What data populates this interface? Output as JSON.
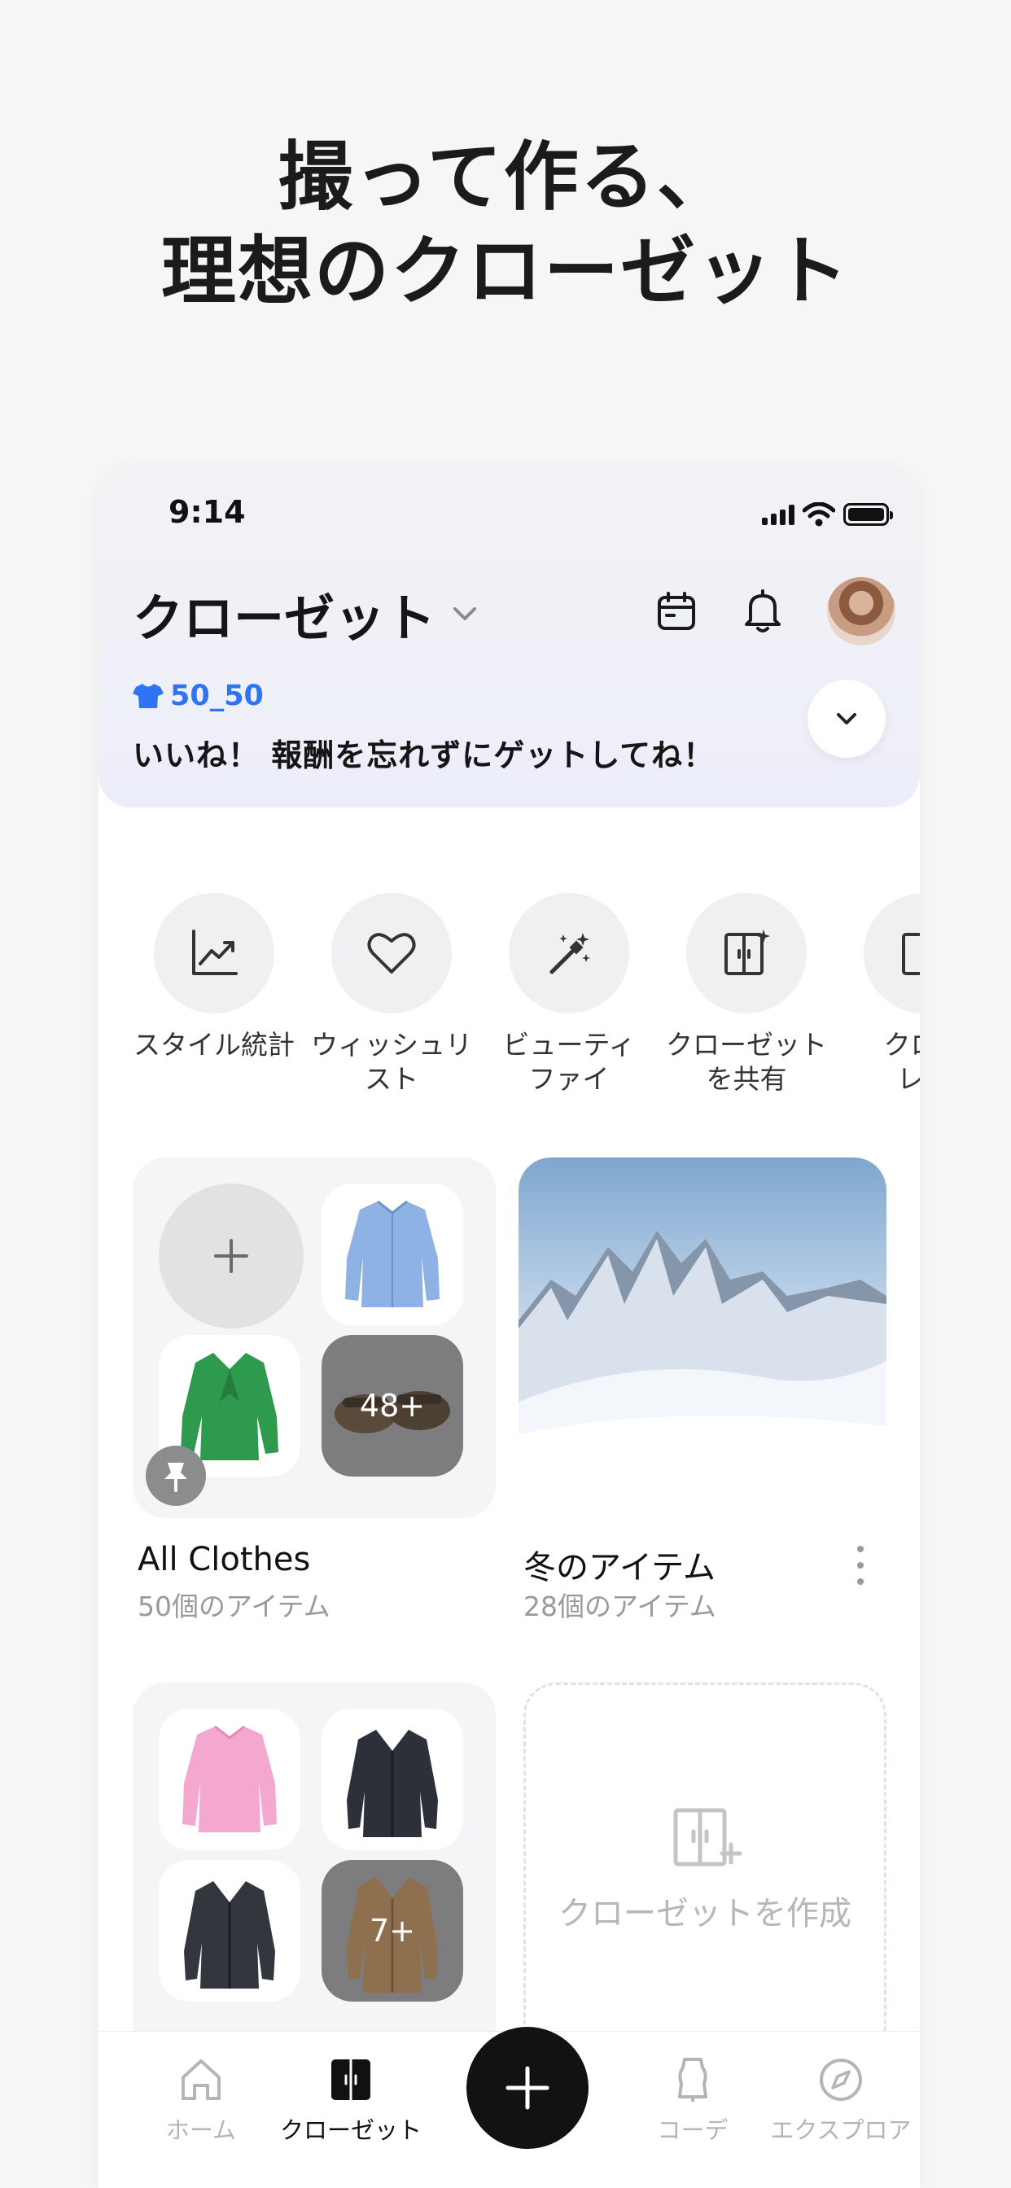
{
  "headline": {
    "line1": "撮って作る、",
    "line2": "理想のクローゼット"
  },
  "status_bar": {
    "time": "9:14"
  },
  "header": {
    "title": "クローゼット"
  },
  "reward": {
    "tag": "50_50",
    "message": "いいね！ 報酬を忘れずにゲットしてね！"
  },
  "quick_actions": [
    {
      "label": "スタイル統計",
      "icon": "trend-chart-icon"
    },
    {
      "label": "ウィッシュリ\nスト",
      "icon": "heart-icon"
    },
    {
      "label": "ビューティ\nファイ",
      "icon": "magic-wand-icon"
    },
    {
      "label": "クローゼット\nを共有",
      "icon": "closet-share-icon"
    },
    {
      "label": "クロー\nレビ",
      "icon": "closet-review-icon"
    }
  ],
  "closets": [
    {
      "name": "All Clothes",
      "count": "50個のアイテム",
      "more": "48+"
    },
    {
      "name": "冬のアイテム",
      "count": "28個のアイテム"
    },
    {
      "more": "7+"
    }
  ],
  "create_closet": {
    "label": "クローゼットを作成"
  },
  "tabbar": {
    "home": "ホーム",
    "closet": "クローゼット",
    "outfit": "コーデ",
    "explore": "エクスプロア"
  },
  "colors": {
    "accent": "#2f74f6",
    "fab": "#121212"
  }
}
